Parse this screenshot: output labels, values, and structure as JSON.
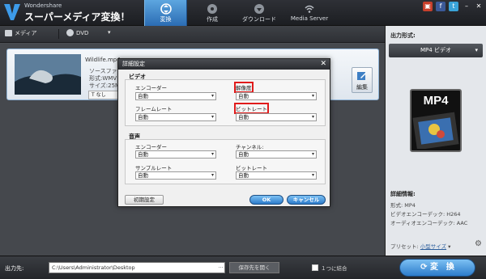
{
  "app": {
    "brand_small": "Wondershare",
    "brand_name": "スーパーメディア変換！",
    "accent_color": "#2f78c6"
  },
  "header": {
    "tabs": [
      {
        "label": "変換",
        "icon": "convert-icon",
        "active": true
      },
      {
        "label": "作成",
        "icon": "disc-icon",
        "active": false
      },
      {
        "label": "ダウンロード",
        "icon": "download-icon",
        "active": false
      },
      {
        "label": "Media Server",
        "icon": "wifi-icon",
        "active": false
      }
    ],
    "window_icons": [
      "gift-icon",
      "facebook-icon",
      "twitter-icon",
      "minimize-icon",
      "close-icon"
    ]
  },
  "toolbar": {
    "media_label": "メディア",
    "dvd_label": "DVD"
  },
  "file": {
    "name": "Wildlife.mp4",
    "meta_lines": [
      "ソースファ",
      "形式:WMV",
      "サイズ:25MB"
    ],
    "subtitle_value": "なし",
    "edit_label": "編集"
  },
  "dialog": {
    "title": "詳細設定",
    "video_section": "ビデオ",
    "audio_section": "音声",
    "video": {
      "encoder_label": "エンコーダー",
      "encoder_value": "自動",
      "resolution_label": "解像度",
      "resolution_value": "自動",
      "framerate_label": "フレームレート",
      "framerate_value": "自動",
      "bitrate_label": "ビットレート",
      "bitrate_value": "自動"
    },
    "audio": {
      "encoder_label": "エンコーダー",
      "encoder_value": "自動",
      "channel_label": "チャンネル:",
      "channel_value": "自動",
      "samplerate_label": "サンプルレート",
      "samplerate_value": "自動",
      "bitrate_label": "ビットレート",
      "bitrate_value": "自動"
    },
    "reset_label": "初期設定",
    "ok_label": "OK",
    "cancel_label": "キャンセル"
  },
  "right_panel": {
    "output_format_title": "出力形式:",
    "format_value": "MP4 ビデオ",
    "format_badge": "MP4",
    "info_title": "詳細情報:",
    "info_lines": [
      "形式: MP4",
      "ビデオエンコーデック: H264",
      "オーディオエンコーデック: AAC"
    ],
    "preset_label": "プリセット: ",
    "preset_value": "小型サイズ"
  },
  "footer": {
    "output_label": "出力先:",
    "output_path": "C:\\Users\\Administrator\\Desktop",
    "browse_label": "...",
    "save_dir_label": "保存先を開く",
    "merge_label": "１つに結合",
    "convert_label": "変　換"
  }
}
